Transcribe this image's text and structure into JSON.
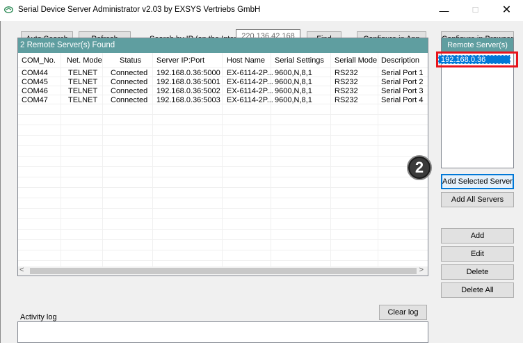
{
  "window": {
    "title": "Serial Device Server Administrator v2.03 by EXSYS Vertriebs GmbH",
    "minimize_glyph": "—",
    "maximize_glyph": "☐",
    "close_glyph": "✕"
  },
  "toolbar": {
    "auto_search": "Auto Search",
    "refresh": "Refresh",
    "search_label": "Search by IP (on the Internet):",
    "ip_value": "220.136.42.168",
    "find": "Find",
    "configure_app": "Configure in App",
    "configure_browser": "Configure in Browser"
  },
  "list": {
    "header": "2 Remote Server(s) Found",
    "columns": [
      "COM_No.",
      "Net. Mode",
      "Status",
      "Server IP:Port",
      "Host Name",
      "Serial Settings",
      "Seriall Mode",
      "Description"
    ],
    "rows": [
      [
        "COM44",
        "TELNET",
        "Connected",
        "192.168.0.36:5000",
        "EX-6114-2P...",
        "9600,N,8,1",
        "RS232",
        "Serial Port 1"
      ],
      [
        "COM45",
        "TELNET",
        "Connected",
        "192.168.0.36:5001",
        "EX-6114-2P...",
        "9600,N,8,1",
        "RS232",
        "Serial Port 2"
      ],
      [
        "COM46",
        "TELNET",
        "Connected",
        "192.168.0.36:5002",
        "EX-6114-2P...",
        "9600,N,8,1",
        "RS232",
        "Serial Port 3"
      ],
      [
        "COM47",
        "TELNET",
        "Connected",
        "192.168.0.36:5003",
        "EX-6114-2P...",
        "9600,N,8,1",
        "RS232",
        "Serial Port 4"
      ]
    ],
    "scroll_left": "<",
    "scroll_right": ">"
  },
  "remote": {
    "header": "Remote Server(s)",
    "items": [
      "192.168.0.36"
    ]
  },
  "actions": {
    "add_selected": "Add Selected Server",
    "add_all": "Add All Servers",
    "add": "Add",
    "edit": "Edit",
    "delete": "Delete",
    "delete_all": "Delete All",
    "clear_log": "Clear log"
  },
  "callout": {
    "step": "2",
    "accent": "#e8141c"
  },
  "log": {
    "label": "Activity log"
  },
  "colors": {
    "header_bar": "#5f9ea0",
    "selection": "#0078d7",
    "highlight": "#e8141c"
  }
}
